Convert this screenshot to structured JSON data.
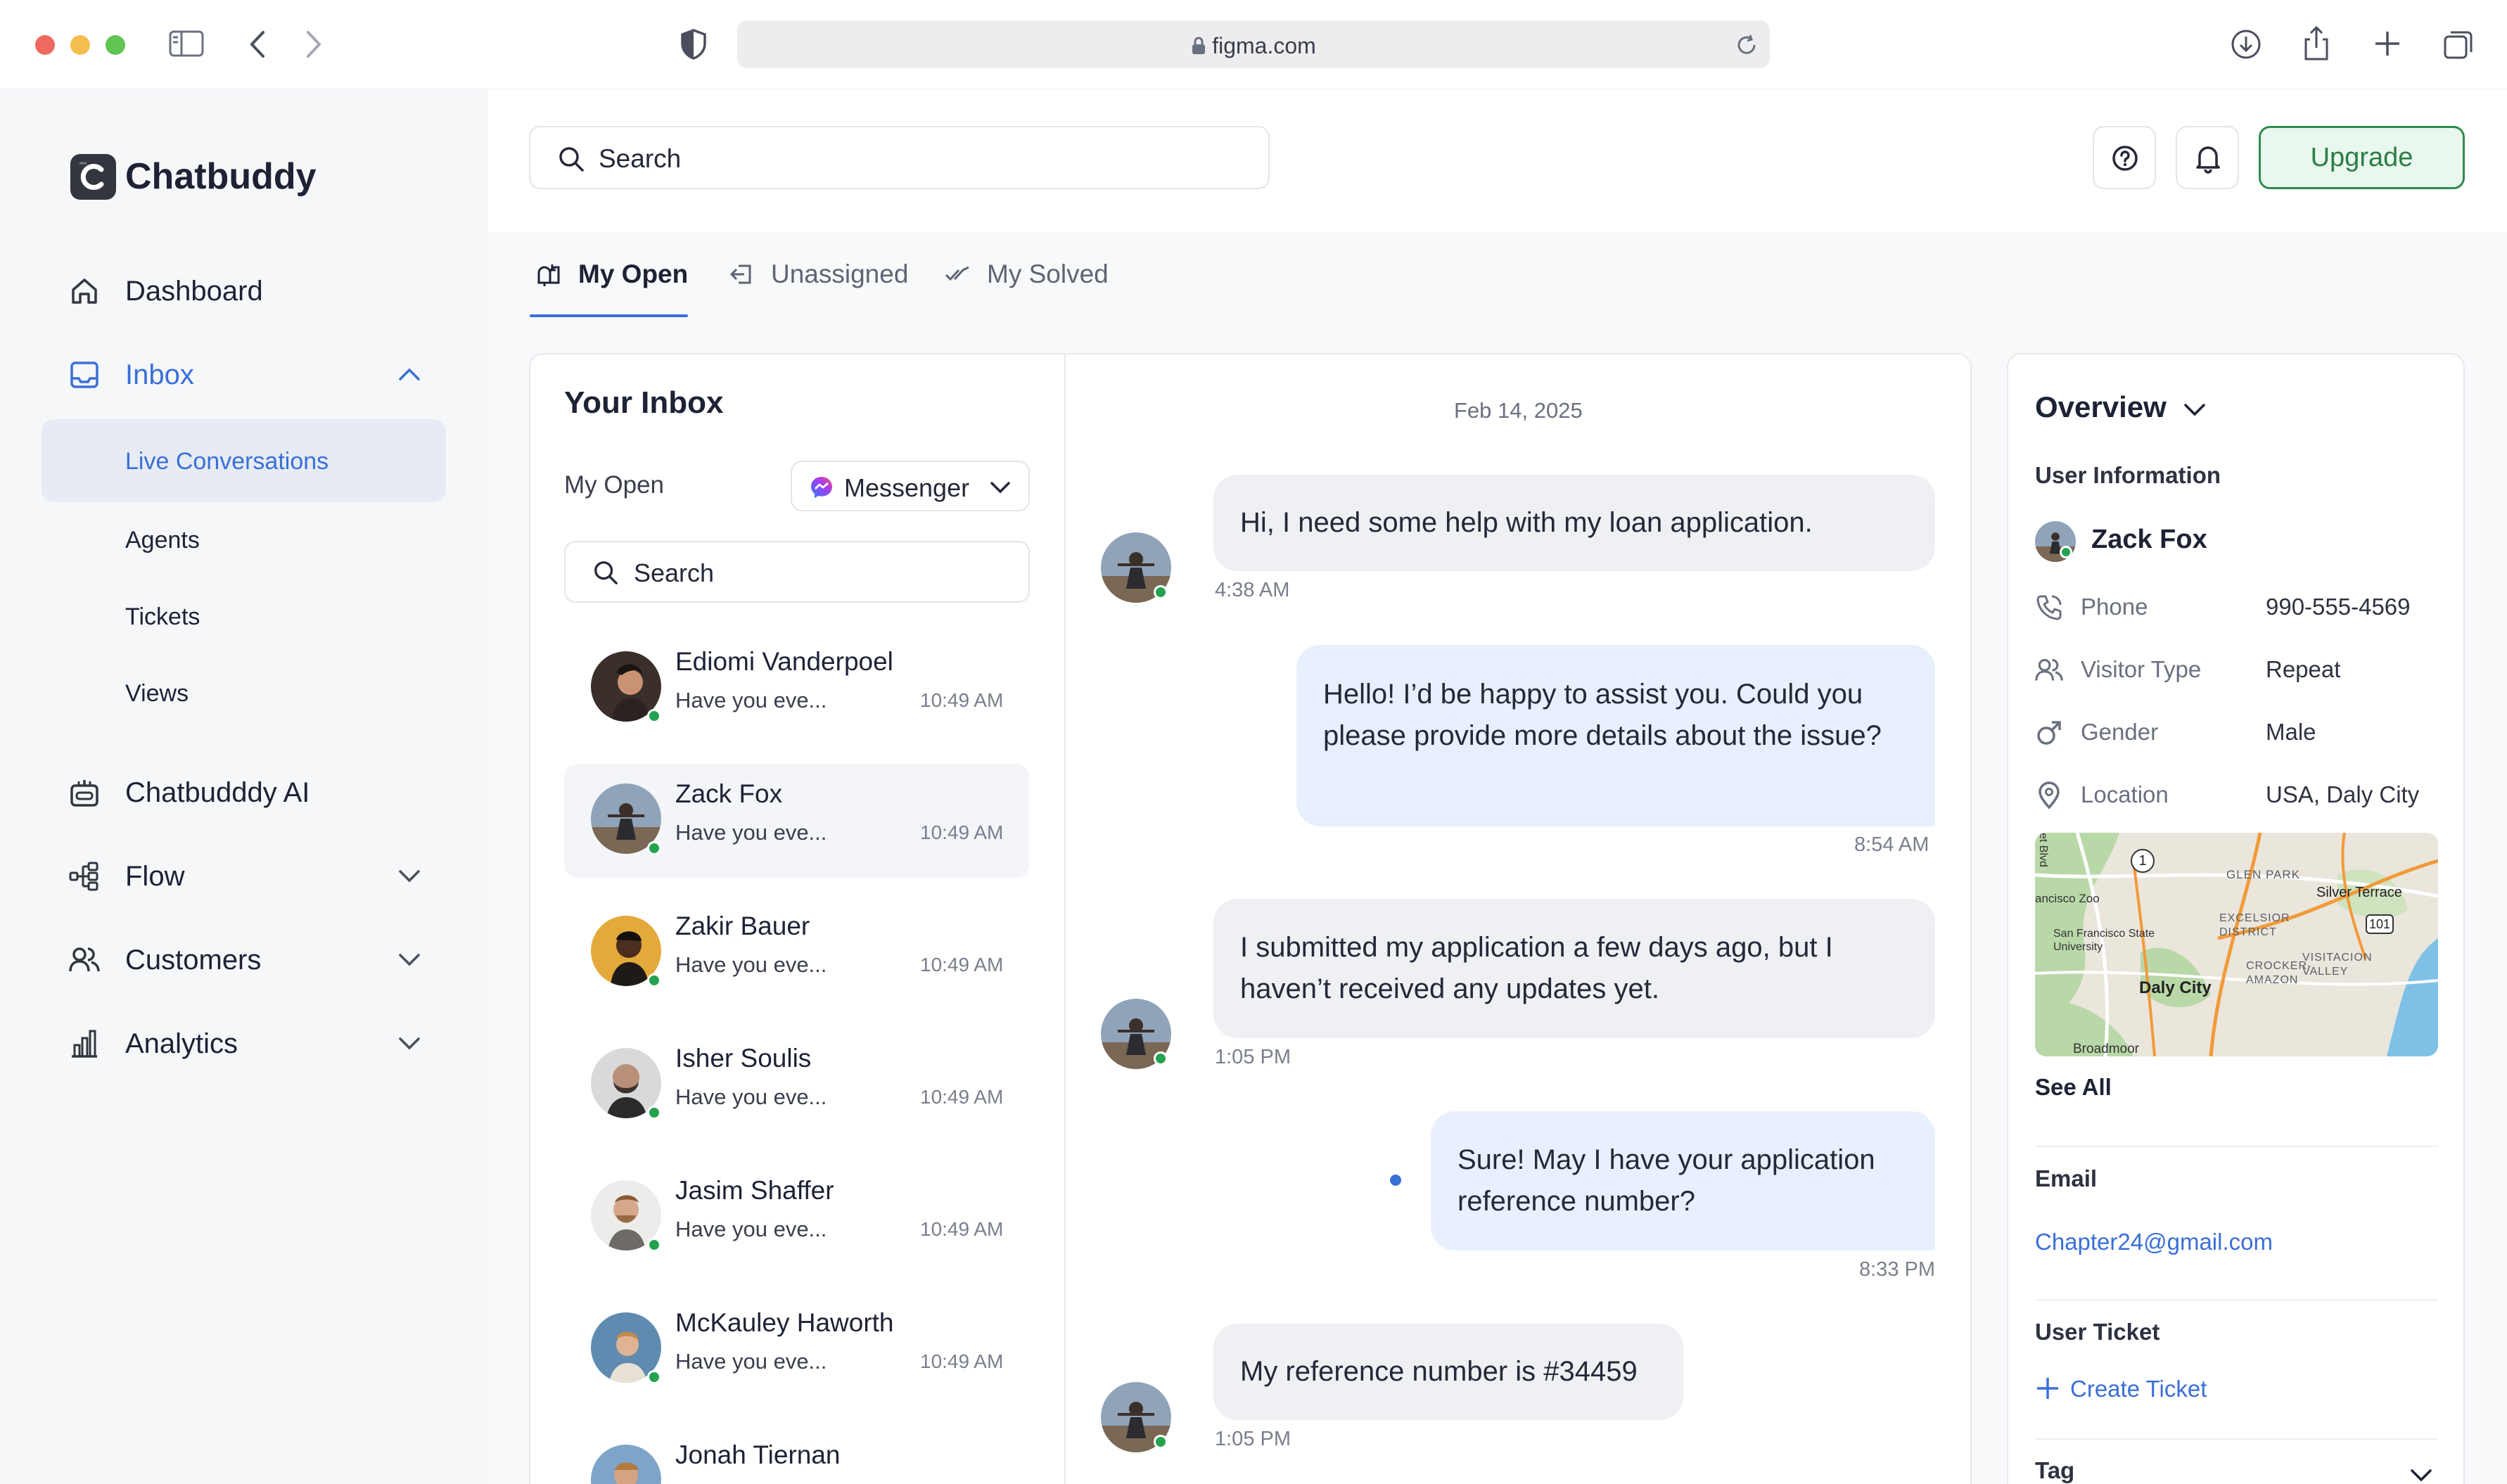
{
  "browser": {
    "url": "figma.com",
    "traffic_colors": [
      "#ee6a5f",
      "#f5bd4f",
      "#61c554"
    ]
  },
  "app": {
    "name": "Chatbuddy",
    "accent": "#3a6fd8",
    "online_color": "#23a350",
    "upgrade_color": "#2f8a4e"
  },
  "sidebar": {
    "items": [
      {
        "label": "Dashboard",
        "icon": "home-icon"
      },
      {
        "label": "Inbox",
        "icon": "inbox-icon",
        "expanded": true,
        "active": true
      },
      {
        "label": "Chatbudddy AI",
        "icon": "robot-icon"
      },
      {
        "label": "Flow",
        "icon": "flow-icon"
      },
      {
        "label": "Customers",
        "icon": "users-icon"
      },
      {
        "label": "Analytics",
        "icon": "chart-icon"
      }
    ],
    "inbox_sub": [
      {
        "label": "Live Conversations",
        "active": true
      },
      {
        "label": "Agents"
      },
      {
        "label": "Tickets"
      },
      {
        "label": "Views"
      }
    ]
  },
  "header": {
    "search_placeholder": "Search",
    "upgrade_label": "Upgrade"
  },
  "tabs": [
    {
      "label": "My Open",
      "icon": "mailbox-icon",
      "active": true
    },
    {
      "label": "Unassigned",
      "icon": "unassigned-icon"
    },
    {
      "label": "My Solved",
      "icon": "double-check-icon"
    }
  ],
  "inbox": {
    "title": "Your Inbox",
    "filter_label": "My Open",
    "channel": "Messenger",
    "search_placeholder": "Search",
    "conversations": [
      {
        "name": "Ediomi Vanderpoel",
        "preview": "Have you eve...",
        "time": "10:49 AM"
      },
      {
        "name": "Zack Fox",
        "preview": "Have you eve...",
        "time": "10:49 AM",
        "selected": true
      },
      {
        "name": "Zakir Bauer",
        "preview": "Have you eve...",
        "time": "10:49 AM"
      },
      {
        "name": "Isher Soulis",
        "preview": "Have you eve...",
        "time": "10:49 AM"
      },
      {
        "name": "Jasim Shaffer",
        "preview": "Have you eve...",
        "time": "10:49 AM"
      },
      {
        "name": "McKauley Haworth",
        "preview": "Have you eve...",
        "time": "10:49 AM"
      },
      {
        "name": "Jonah Tiernan",
        "preview": "",
        "time": ""
      }
    ]
  },
  "chat": {
    "date": "Feb 14, 2025",
    "messages": [
      {
        "from": "user",
        "text": "Hi, I need some help with my loan application.",
        "time": "4:38 AM"
      },
      {
        "from": "agent",
        "text": "Hello! I’d be happy to assist you. Could you please provide more details about the issue?",
        "time": "8:54 AM"
      },
      {
        "from": "user",
        "text": "I submitted my application a few days ago, but I haven’t  received  any updates yet.",
        "time": "1:05 PM"
      },
      {
        "from": "agent",
        "text": "Sure! May I have your application reference number?",
        "time": "8:33 PM"
      },
      {
        "from": "user",
        "text": "My reference number is #34459",
        "time": "1:05 PM"
      }
    ]
  },
  "overview": {
    "title": "Overview",
    "user_info_title": "User Information",
    "user_name": "Zack Fox",
    "fields": [
      {
        "label": "Phone",
        "value": "990-555-4569",
        "icon": "phone-icon"
      },
      {
        "label": "Visitor Type",
        "value": "Repeat",
        "icon": "visitor-icon"
      },
      {
        "label": "Gender",
        "value": "Male",
        "icon": "male-icon"
      },
      {
        "label": "Location",
        "value": "USA, Daly City",
        "icon": "location-pin-icon"
      }
    ],
    "map_labels": [
      "GLEN PARK",
      "Silver Terrace",
      "ancisco Zoo",
      "San Francisco State University",
      "EXCELSIOR DISTRICT",
      "VISITACION VALLEY",
      "CROCKER-AMAZON",
      "Daly City",
      "Broadmoor",
      "et Blvd",
      "1",
      "101"
    ],
    "see_all": "See All",
    "email_title": "Email",
    "email": "Chapter24@gmail.com",
    "ticket_title": "User Ticket",
    "create_ticket": "Create Ticket",
    "tag_title": "Tag"
  }
}
